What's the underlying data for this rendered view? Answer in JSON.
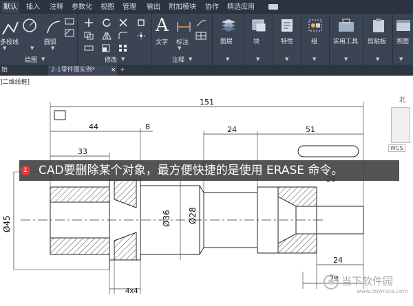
{
  "menubar": {
    "tabs": [
      "默认",
      "插入",
      "注释",
      "参数化",
      "视图",
      "管理",
      "输出",
      "附加模块",
      "协作",
      "精选应用"
    ]
  },
  "ribbon": {
    "draw_tools": [
      "多段线",
      "圆弧"
    ],
    "draw_group": "绘图",
    "modify_group": "修改",
    "annotation_tools": [
      "文字",
      "标注"
    ],
    "annotation_group": "注释",
    "right_tools": [
      "图层",
      "块",
      "特性",
      "组",
      "实用工具",
      "剪贴板",
      "视图"
    ]
  },
  "doc_tabs": {
    "start": "始",
    "drawing": "2-1零件图实例*",
    "close_glyph": "×",
    "add_glyph": "+"
  },
  "viewport_label": "]二维线框]",
  "viewcube": {
    "north": "北",
    "south": "南",
    "wcs": "WCS"
  },
  "caption": {
    "badge": "1",
    "text": "CAD要删除某个对象，最方便快捷的是使用 ERASE 命令。"
  },
  "dimensions": {
    "overall": "151",
    "d44": "44",
    "d8": "8",
    "d24_top": "24",
    "d51": "51",
    "d33": "33",
    "d26": "26",
    "dia45": "Ø45",
    "dia36": "Ø36",
    "dia28": "Ø28",
    "d24_bottom": "24",
    "d4x4": "4x4",
    "d29": "29"
  },
  "watermark": {
    "text": "当下软件园",
    "url": "www.downxia.com"
  },
  "colors": {
    "ribbon_bg": "#3b4453",
    "menu_bg": "#2b3340",
    "badge": "#e23b3b"
  }
}
